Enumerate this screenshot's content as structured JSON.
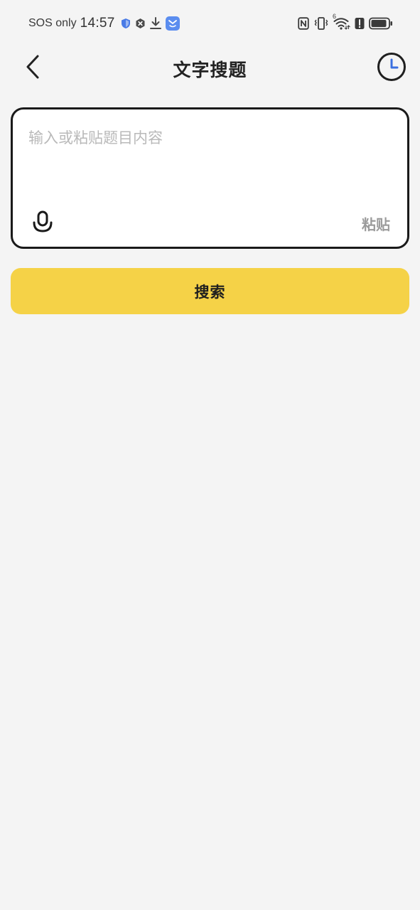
{
  "status_bar": {
    "carrier": "SOS only",
    "time": "14:57",
    "left_icons": [
      "shield-icon",
      "blocked-icon",
      "download-icon",
      "app-notification-icon"
    ],
    "right_icons": [
      "nfc-icon",
      "vibrate-icon",
      "wifi-icon",
      "alert-icon",
      "battery-icon"
    ],
    "wifi_badge": "6"
  },
  "header": {
    "title": "文字搜题",
    "back_icon": "chevron-left-icon",
    "history_icon": "clock-icon"
  },
  "input_card": {
    "value": "",
    "placeholder": "输入或粘贴题目内容",
    "mic_icon": "microphone-icon",
    "paste_label": "粘贴"
  },
  "search_button": {
    "label": "搜索"
  },
  "colors": {
    "background": "#f4f4f4",
    "accent": "#f5d247",
    "card_border": "#1a1a1a",
    "placeholder": "#b9b9b9",
    "history_hand": "#3a6fe0"
  }
}
